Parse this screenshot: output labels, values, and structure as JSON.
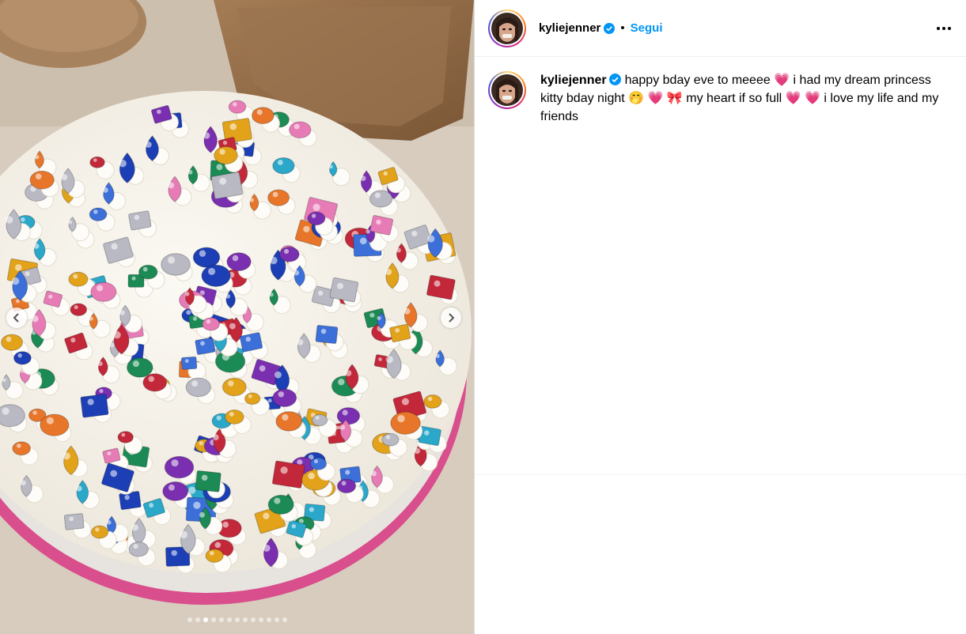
{
  "post": {
    "author": {
      "username": "kyliejenner",
      "verified_icon": "verified-badge-icon",
      "avatar": "profile-avatar"
    },
    "header": {
      "separator": "•",
      "follow_label": "Segui",
      "more_icon": "more-options-icon"
    },
    "caption": {
      "username": "kyliejenner",
      "text": "happy bday eve to meeee 💗 i had my dream princess kitty bday night 🤭 💗 🎀  my heart if so full 💗 💗  i love my life and my friends"
    },
    "media": {
      "subject": "jeweled birthday cake photo",
      "carousel_total": 13,
      "carousel_current": 3,
      "prev_icon": "chevron-left-icon",
      "next_icon": "chevron-right-icon"
    }
  },
  "colors": {
    "accent": "#0095f6",
    "verified": "#0095f6",
    "divider": "#dbdbdb"
  }
}
